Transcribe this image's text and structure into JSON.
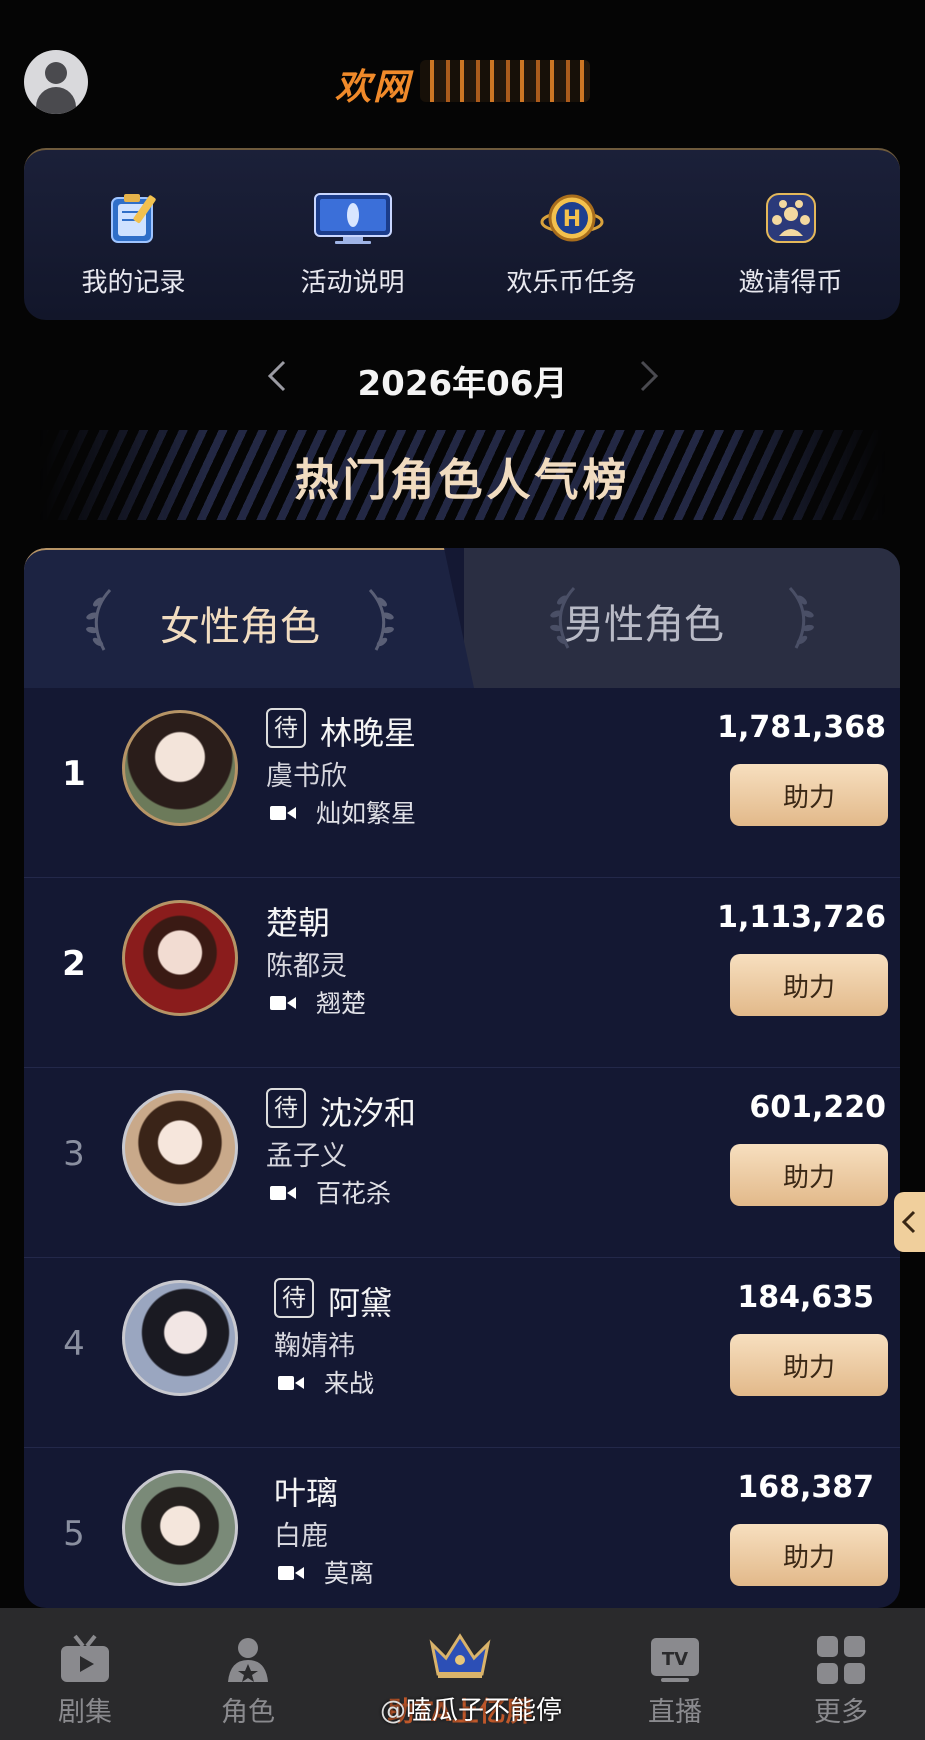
{
  "header": {
    "brand_visible": "欢网",
    "avatar_icon": "user-avatar-icon"
  },
  "menu": [
    {
      "label": "我的记录",
      "icon": "notebook-pen-icon"
    },
    {
      "label": "活动说明",
      "icon": "screen-display-icon"
    },
    {
      "label": "欢乐币任务",
      "icon": "h-coin-icon"
    },
    {
      "label": "邀请得币",
      "icon": "people-network-icon"
    }
  ],
  "date": {
    "label": "2026年06月"
  },
  "ranking": {
    "title": "热门角色人气榜"
  },
  "tabs": {
    "female": "女性角色",
    "male": "男性角色",
    "active": "female"
  },
  "rows": [
    {
      "rank": "1",
      "pending": true,
      "pending_tag": "待",
      "name": "林晚星",
      "actor": "虞书欣",
      "drama": "灿如繁星",
      "score": "1,781,368",
      "button": "助力"
    },
    {
      "rank": "2",
      "pending": false,
      "pending_tag": "",
      "name": "楚朝",
      "actor": "陈都灵",
      "drama": "翘楚",
      "score": "1,113,726",
      "button": "助力"
    },
    {
      "rank": "3",
      "pending": true,
      "pending_tag": "待",
      "name": "沈汐和",
      "actor": "孟子义",
      "drama": "百花杀",
      "score": "601,220",
      "button": "助力"
    },
    {
      "rank": "4",
      "pending": true,
      "pending_tag": "待",
      "name": "阿黛",
      "actor": "鞠婧祎",
      "drama": "来战",
      "score": "184,635",
      "button": "助力"
    },
    {
      "rank": "5",
      "pending": false,
      "pending_tag": "",
      "name": "叶璃",
      "actor": "白鹿",
      "drama": "莫离",
      "score": "168,387",
      "button": "助力"
    }
  ],
  "nav": [
    {
      "label": "剧集",
      "icon": "tv-play-icon"
    },
    {
      "label": "角色",
      "icon": "character-icon"
    },
    {
      "label": "助TA上亿屏",
      "icon": "crown-icon"
    },
    {
      "label": "直播",
      "icon": "tv-live-icon"
    },
    {
      "label": "更多",
      "icon": "grid-more-icon"
    }
  ],
  "watermark": {
    "at": "@",
    "text": "嗑瓜子不能停"
  },
  "colors": {
    "background": "#050505",
    "card": "#141833",
    "accent_gold": "#e2b98a",
    "brand_orange": "#f08a2a",
    "nav_active": "#c0582a"
  }
}
